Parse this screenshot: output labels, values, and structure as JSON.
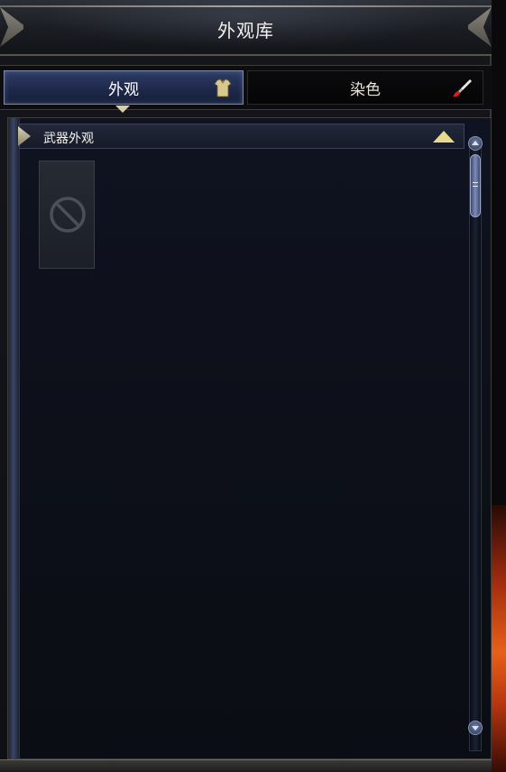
{
  "window": {
    "title": "外观库"
  },
  "tabs": [
    {
      "label": "外观",
      "icon": "armor-icon",
      "active": true
    },
    {
      "label": "染色",
      "icon": "paint-brush-icon",
      "active": false
    }
  ],
  "section": {
    "title": "武器外观",
    "expanded": true
  },
  "slots": [
    {
      "icon": "empty-slot-icon",
      "empty": true
    }
  ],
  "colors": {
    "active_tab": "#1d2748",
    "collapse_arrow": "#e9d98e",
    "panel_bg": "#0d1019"
  }
}
